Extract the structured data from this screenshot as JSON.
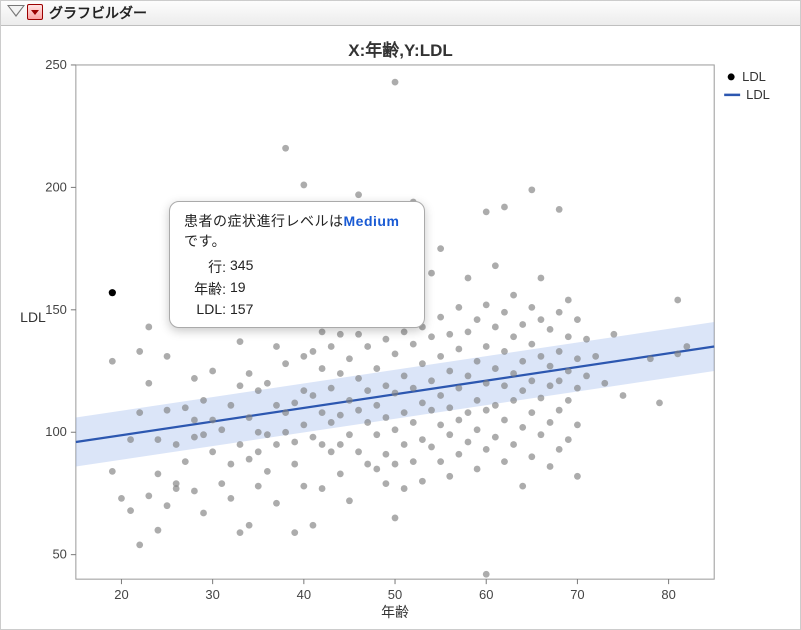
{
  "titlebar": {
    "text": "グラフビルダー"
  },
  "chart_title": "X:年齢,Y:LDL",
  "legend": {
    "points_label": "LDL",
    "line_label": "LDL"
  },
  "axis": {
    "x_label": "年齢",
    "y_label": "LDL",
    "x_ticks": [
      "20",
      "30",
      "40",
      "50",
      "60",
      "70",
      "80"
    ],
    "y_ticks": [
      "50",
      "100",
      "150",
      "200",
      "250"
    ]
  },
  "tooltip": {
    "headline_prefix": "患者の症状進行レベルは",
    "headline_value": "Medium",
    "headline_suffix": "です。",
    "row_label": "行:",
    "row_value": "345",
    "age_label": "年齢:",
    "age_value": "19",
    "ldl_label": "LDL:",
    "ldl_value": "157"
  },
  "chart_data": {
    "type": "scatter",
    "title": "X:年齢,Y:LDL",
    "xlabel": "年齢",
    "ylabel": "LDL",
    "xlim": [
      15,
      85
    ],
    "ylim": [
      40,
      250
    ],
    "series": [
      {
        "name": "LDL",
        "kind": "scatter",
        "points": [
          [
            19,
            157
          ],
          [
            19,
            129
          ],
          [
            19,
            84
          ],
          [
            20,
            73
          ],
          [
            21,
            68
          ],
          [
            21,
            97
          ],
          [
            22,
            108
          ],
          [
            22,
            133
          ],
          [
            22,
            54
          ],
          [
            23,
            74
          ],
          [
            23,
            120
          ],
          [
            23,
            143
          ],
          [
            24,
            83
          ],
          [
            24,
            97
          ],
          [
            24,
            60
          ],
          [
            25,
            70
          ],
          [
            25,
            109
          ],
          [
            25,
            131
          ],
          [
            26,
            79
          ],
          [
            26,
            95
          ],
          [
            26,
            77
          ],
          [
            27,
            88
          ],
          [
            27,
            110
          ],
          [
            28,
            122
          ],
          [
            28,
            98
          ],
          [
            28,
            105
          ],
          [
            28,
            76
          ],
          [
            29,
            67
          ],
          [
            29,
            113
          ],
          [
            29,
            99
          ],
          [
            30,
            92
          ],
          [
            30,
            125
          ],
          [
            30,
            144
          ],
          [
            30,
            105
          ],
          [
            31,
            185
          ],
          [
            31,
            79
          ],
          [
            31,
            101
          ],
          [
            32,
            87
          ],
          [
            32,
            111
          ],
          [
            32,
            73
          ],
          [
            33,
            59
          ],
          [
            33,
            95
          ],
          [
            33,
            137
          ],
          [
            33,
            119
          ],
          [
            34,
            106
          ],
          [
            34,
            89
          ],
          [
            34,
            62
          ],
          [
            34,
            124
          ],
          [
            35,
            117
          ],
          [
            35,
            100
          ],
          [
            35,
            92
          ],
          [
            35,
            78
          ],
          [
            36,
            120
          ],
          [
            36,
            153
          ],
          [
            36,
            99
          ],
          [
            36,
            84
          ],
          [
            37,
            111
          ],
          [
            37,
            135
          ],
          [
            37,
            95
          ],
          [
            37,
            71
          ],
          [
            38,
            108
          ],
          [
            38,
            128
          ],
          [
            38,
            100
          ],
          [
            38,
            216
          ],
          [
            38,
            183
          ],
          [
            39,
            150
          ],
          [
            39,
            112
          ],
          [
            39,
            96
          ],
          [
            39,
            87
          ],
          [
            39,
            59
          ],
          [
            40,
            201
          ],
          [
            40,
            131
          ],
          [
            40,
            117
          ],
          [
            40,
            103
          ],
          [
            40,
            78
          ],
          [
            41,
            98
          ],
          [
            41,
            115
          ],
          [
            41,
            133
          ],
          [
            41,
            144
          ],
          [
            41,
            62
          ],
          [
            42,
            126
          ],
          [
            42,
            141
          ],
          [
            42,
            108
          ],
          [
            42,
            95
          ],
          [
            42,
            77
          ],
          [
            43,
            92
          ],
          [
            43,
            118
          ],
          [
            43,
            104
          ],
          [
            43,
            135
          ],
          [
            43,
            168
          ],
          [
            44,
            107
          ],
          [
            44,
            124
          ],
          [
            44,
            95
          ],
          [
            44,
            83
          ],
          [
            44,
            140
          ],
          [
            45,
            113
          ],
          [
            45,
            99
          ],
          [
            45,
            130
          ],
          [
            45,
            72
          ],
          [
            45,
            146
          ],
          [
            46,
            109
          ],
          [
            46,
            92
          ],
          [
            46,
            122
          ],
          [
            46,
            140
          ],
          [
            46,
            197
          ],
          [
            47,
            104
          ],
          [
            47,
            117
          ],
          [
            47,
            87
          ],
          [
            47,
            135
          ],
          [
            47,
            160
          ],
          [
            48,
            111
          ],
          [
            48,
            99
          ],
          [
            48,
            145
          ],
          [
            48,
            85
          ],
          [
            48,
            126
          ],
          [
            49,
            106
          ],
          [
            49,
            119
          ],
          [
            49,
            91
          ],
          [
            49,
            138
          ],
          [
            49,
            79
          ],
          [
            50,
            243
          ],
          [
            50,
            116
          ],
          [
            50,
            132
          ],
          [
            50,
            101
          ],
          [
            50,
            87
          ],
          [
            50,
            154
          ],
          [
            50,
            65
          ],
          [
            51,
            108
          ],
          [
            51,
            123
          ],
          [
            51,
            141
          ],
          [
            51,
            95
          ],
          [
            51,
            77
          ],
          [
            52,
            118
          ],
          [
            52,
            104
          ],
          [
            52,
            136
          ],
          [
            52,
            149
          ],
          [
            52,
            88
          ],
          [
            52,
            194
          ],
          [
            53,
            112
          ],
          [
            53,
            128
          ],
          [
            53,
            97
          ],
          [
            53,
            143
          ],
          [
            53,
            80
          ],
          [
            54,
            121
          ],
          [
            54,
            109
          ],
          [
            54,
            139
          ],
          [
            54,
            94
          ],
          [
            54,
            165
          ],
          [
            55,
            115
          ],
          [
            55,
            103
          ],
          [
            55,
            131
          ],
          [
            55,
            147
          ],
          [
            55,
            88
          ],
          [
            55,
            175
          ],
          [
            56,
            110
          ],
          [
            56,
            125
          ],
          [
            56,
            99
          ],
          [
            56,
            140
          ],
          [
            56,
            82
          ],
          [
            57,
            118
          ],
          [
            57,
            134
          ],
          [
            57,
            105
          ],
          [
            57,
            151
          ],
          [
            57,
            91
          ],
          [
            58,
            123
          ],
          [
            58,
            108
          ],
          [
            58,
            141
          ],
          [
            58,
            96
          ],
          [
            58,
            163
          ],
          [
            59,
            113
          ],
          [
            59,
            129
          ],
          [
            59,
            146
          ],
          [
            59,
            101
          ],
          [
            59,
            85
          ],
          [
            60,
            120
          ],
          [
            60,
            135
          ],
          [
            60,
            109
          ],
          [
            60,
            152
          ],
          [
            60,
            93
          ],
          [
            60,
            190
          ],
          [
            60,
            42
          ],
          [
            61,
            126
          ],
          [
            61,
            111
          ],
          [
            61,
            143
          ],
          [
            61,
            98
          ],
          [
            61,
            168
          ],
          [
            62,
            119
          ],
          [
            62,
            133
          ],
          [
            62,
            105
          ],
          [
            62,
            149
          ],
          [
            62,
            88
          ],
          [
            62,
            192
          ],
          [
            63,
            124
          ],
          [
            63,
            139
          ],
          [
            63,
            113
          ],
          [
            63,
            156
          ],
          [
            63,
            95
          ],
          [
            64,
            129
          ],
          [
            64,
            117
          ],
          [
            64,
            144
          ],
          [
            64,
            102
          ],
          [
            64,
            78
          ],
          [
            65,
            121
          ],
          [
            65,
            136
          ],
          [
            65,
            108
          ],
          [
            65,
            151
          ],
          [
            65,
            90
          ],
          [
            65,
            199
          ],
          [
            66,
            114
          ],
          [
            66,
            131
          ],
          [
            66,
            146
          ],
          [
            66,
            99
          ],
          [
            66,
            163
          ],
          [
            67,
            127
          ],
          [
            67,
            142
          ],
          [
            67,
            119
          ],
          [
            67,
            104
          ],
          [
            67,
            86
          ],
          [
            68,
            133
          ],
          [
            68,
            121
          ],
          [
            68,
            149
          ],
          [
            68,
            109
          ],
          [
            68,
            93
          ],
          [
            68,
            191
          ],
          [
            69,
            125
          ],
          [
            69,
            139
          ],
          [
            69,
            113
          ],
          [
            69,
            154
          ],
          [
            69,
            97
          ],
          [
            70,
            130
          ],
          [
            70,
            146
          ],
          [
            70,
            118
          ],
          [
            70,
            103
          ],
          [
            70,
            82
          ],
          [
            71,
            123
          ],
          [
            71,
            138
          ],
          [
            72,
            131
          ],
          [
            73,
            120
          ],
          [
            74,
            140
          ],
          [
            75,
            115
          ],
          [
            78,
            130
          ],
          [
            79,
            112
          ],
          [
            81,
            132
          ],
          [
            81,
            154
          ],
          [
            82,
            135
          ]
        ]
      },
      {
        "name": "LDL",
        "kind": "line_fit",
        "line_x": [
          15,
          85
        ],
        "line_y": [
          96,
          135
        ],
        "band_upper_y": [
          106,
          145
        ],
        "band_lower_y": [
          86,
          125
        ]
      }
    ],
    "highlight_point": {
      "x": 19,
      "y": 157
    }
  }
}
